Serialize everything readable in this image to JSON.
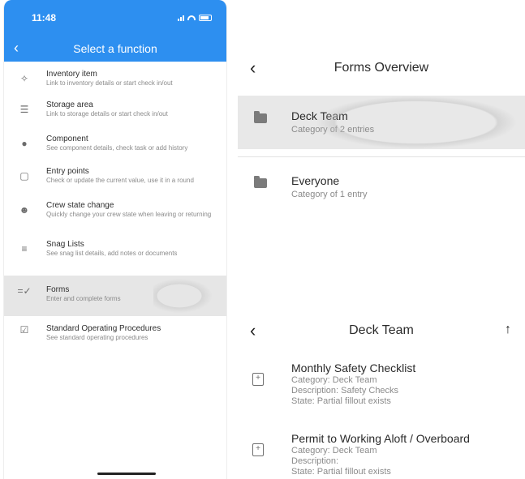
{
  "status": {
    "time": "11:48"
  },
  "left": {
    "title": "Select a function",
    "back_icon": "chevron-left-icon",
    "items": [
      {
        "icon": "puzzle-icon",
        "title": "Inventory item",
        "sub": "Link to inventory details or start check in/out"
      },
      {
        "icon": "list-icon",
        "title": "Storage area",
        "sub": "Link to storage details or start check in/out"
      },
      {
        "icon": "lightbulb-icon",
        "title": "Component",
        "sub": "See component details, check task or add history"
      },
      {
        "icon": "entry-points-icon",
        "title": "Entry points",
        "sub": "Check or update the current value, use it in a round"
      },
      {
        "icon": "crew-icon",
        "title": "Crew state change",
        "sub": "Quickly change your crew state when leaving or returning"
      },
      {
        "icon": "checklist-icon",
        "title": "Snag Lists",
        "sub": "See snag list details, add notes or documents"
      },
      {
        "icon": "forms-icon",
        "title": "Forms",
        "sub": "Enter and complete forms"
      },
      {
        "icon": "calendar-check-icon",
        "title": "Standard Operating Procedures",
        "sub": "See standard operating procedures"
      }
    ]
  },
  "overview": {
    "title": "Forms Overview",
    "categories": [
      {
        "title": "Deck Team",
        "sub": "Category of 2 entries"
      },
      {
        "title": "Everyone",
        "sub": "Category of 1 entry"
      }
    ]
  },
  "deck": {
    "title": "Deck Team",
    "forms": [
      {
        "title": "Monthly Safety Checklist",
        "category": "Category: Deck Team",
        "description": "Description: Safety Checks",
        "state": "State: Partial fillout exists"
      },
      {
        "title": "Permit to Working Aloft / Overboard",
        "category": "Category: Deck Team",
        "description": "Description:",
        "state": "State: Partial fillout exists"
      }
    ]
  }
}
